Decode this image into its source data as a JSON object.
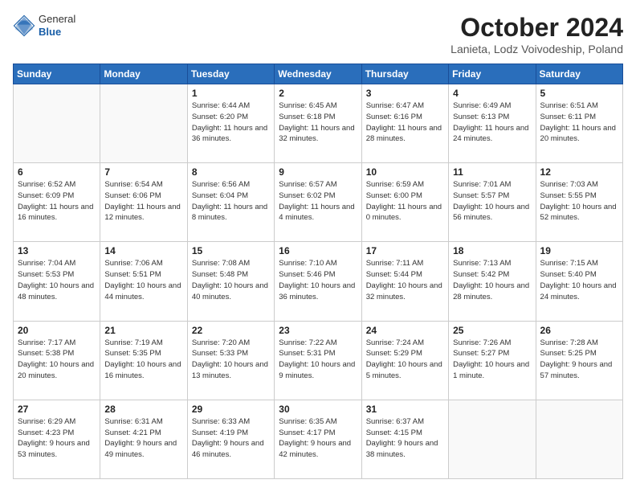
{
  "header": {
    "logo_general": "General",
    "logo_blue": "Blue",
    "month_title": "October 2024",
    "location": "Lanieta, Lodz Voivodeship, Poland"
  },
  "weekdays": [
    "Sunday",
    "Monday",
    "Tuesday",
    "Wednesday",
    "Thursday",
    "Friday",
    "Saturday"
  ],
  "weeks": [
    [
      {
        "day": "",
        "info": ""
      },
      {
        "day": "",
        "info": ""
      },
      {
        "day": "1",
        "info": "Sunrise: 6:44 AM\nSunset: 6:20 PM\nDaylight: 11 hours and 36 minutes."
      },
      {
        "day": "2",
        "info": "Sunrise: 6:45 AM\nSunset: 6:18 PM\nDaylight: 11 hours and 32 minutes."
      },
      {
        "day": "3",
        "info": "Sunrise: 6:47 AM\nSunset: 6:16 PM\nDaylight: 11 hours and 28 minutes."
      },
      {
        "day": "4",
        "info": "Sunrise: 6:49 AM\nSunset: 6:13 PM\nDaylight: 11 hours and 24 minutes."
      },
      {
        "day": "5",
        "info": "Sunrise: 6:51 AM\nSunset: 6:11 PM\nDaylight: 11 hours and 20 minutes."
      }
    ],
    [
      {
        "day": "6",
        "info": "Sunrise: 6:52 AM\nSunset: 6:09 PM\nDaylight: 11 hours and 16 minutes."
      },
      {
        "day": "7",
        "info": "Sunrise: 6:54 AM\nSunset: 6:06 PM\nDaylight: 11 hours and 12 minutes."
      },
      {
        "day": "8",
        "info": "Sunrise: 6:56 AM\nSunset: 6:04 PM\nDaylight: 11 hours and 8 minutes."
      },
      {
        "day": "9",
        "info": "Sunrise: 6:57 AM\nSunset: 6:02 PM\nDaylight: 11 hours and 4 minutes."
      },
      {
        "day": "10",
        "info": "Sunrise: 6:59 AM\nSunset: 6:00 PM\nDaylight: 11 hours and 0 minutes."
      },
      {
        "day": "11",
        "info": "Sunrise: 7:01 AM\nSunset: 5:57 PM\nDaylight: 10 hours and 56 minutes."
      },
      {
        "day": "12",
        "info": "Sunrise: 7:03 AM\nSunset: 5:55 PM\nDaylight: 10 hours and 52 minutes."
      }
    ],
    [
      {
        "day": "13",
        "info": "Sunrise: 7:04 AM\nSunset: 5:53 PM\nDaylight: 10 hours and 48 minutes."
      },
      {
        "day": "14",
        "info": "Sunrise: 7:06 AM\nSunset: 5:51 PM\nDaylight: 10 hours and 44 minutes."
      },
      {
        "day": "15",
        "info": "Sunrise: 7:08 AM\nSunset: 5:48 PM\nDaylight: 10 hours and 40 minutes."
      },
      {
        "day": "16",
        "info": "Sunrise: 7:10 AM\nSunset: 5:46 PM\nDaylight: 10 hours and 36 minutes."
      },
      {
        "day": "17",
        "info": "Sunrise: 7:11 AM\nSunset: 5:44 PM\nDaylight: 10 hours and 32 minutes."
      },
      {
        "day": "18",
        "info": "Sunrise: 7:13 AM\nSunset: 5:42 PM\nDaylight: 10 hours and 28 minutes."
      },
      {
        "day": "19",
        "info": "Sunrise: 7:15 AM\nSunset: 5:40 PM\nDaylight: 10 hours and 24 minutes."
      }
    ],
    [
      {
        "day": "20",
        "info": "Sunrise: 7:17 AM\nSunset: 5:38 PM\nDaylight: 10 hours and 20 minutes."
      },
      {
        "day": "21",
        "info": "Sunrise: 7:19 AM\nSunset: 5:35 PM\nDaylight: 10 hours and 16 minutes."
      },
      {
        "day": "22",
        "info": "Sunrise: 7:20 AM\nSunset: 5:33 PM\nDaylight: 10 hours and 13 minutes."
      },
      {
        "day": "23",
        "info": "Sunrise: 7:22 AM\nSunset: 5:31 PM\nDaylight: 10 hours and 9 minutes."
      },
      {
        "day": "24",
        "info": "Sunrise: 7:24 AM\nSunset: 5:29 PM\nDaylight: 10 hours and 5 minutes."
      },
      {
        "day": "25",
        "info": "Sunrise: 7:26 AM\nSunset: 5:27 PM\nDaylight: 10 hours and 1 minute."
      },
      {
        "day": "26",
        "info": "Sunrise: 7:28 AM\nSunset: 5:25 PM\nDaylight: 9 hours and 57 minutes."
      }
    ],
    [
      {
        "day": "27",
        "info": "Sunrise: 6:29 AM\nSunset: 4:23 PM\nDaylight: 9 hours and 53 minutes."
      },
      {
        "day": "28",
        "info": "Sunrise: 6:31 AM\nSunset: 4:21 PM\nDaylight: 9 hours and 49 minutes."
      },
      {
        "day": "29",
        "info": "Sunrise: 6:33 AM\nSunset: 4:19 PM\nDaylight: 9 hours and 46 minutes."
      },
      {
        "day": "30",
        "info": "Sunrise: 6:35 AM\nSunset: 4:17 PM\nDaylight: 9 hours and 42 minutes."
      },
      {
        "day": "31",
        "info": "Sunrise: 6:37 AM\nSunset: 4:15 PM\nDaylight: 9 hours and 38 minutes."
      },
      {
        "day": "",
        "info": ""
      },
      {
        "day": "",
        "info": ""
      }
    ]
  ]
}
